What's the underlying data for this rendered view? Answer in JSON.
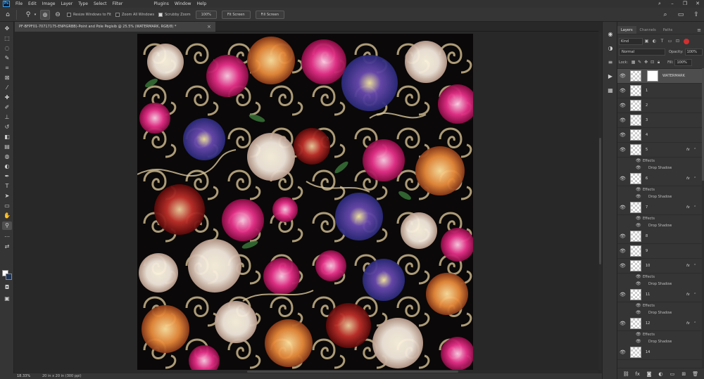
{
  "menu": {
    "app_icon": "Ps",
    "items": [
      "File",
      "Edit",
      "Image",
      "Layer",
      "Type",
      "Select",
      "Filter"
    ],
    "items_right": [
      "Plugins",
      "Window",
      "Help"
    ]
  },
  "window_controls": {
    "search": "⌕",
    "minimize": "–",
    "restore": "❐",
    "close": "✕"
  },
  "options_bar": {
    "resize_windows_label": "Resize Windows to Fit",
    "zoom_all_label": "Zoom All Windows",
    "scrubby_zoom_label": "Scrubby Zoom",
    "scrubby_zoom_checked": true,
    "btn_100": "100%",
    "btn_fit": "Fit Screen",
    "btn_fill": "Fill Screen"
  },
  "document": {
    "tab_title": "PF-BFPF01-70717175-ENPIGRBB)-Point and Pole Pegisib @ 25.5% (WATERMARK, RGB/8) *",
    "close": "×"
  },
  "status": {
    "zoom": "18.33%",
    "doc_size": "20 in x 20 in (300 ppi)"
  },
  "layers_panel": {
    "tabs": [
      "Layers",
      "Channels",
      "Paths"
    ],
    "active_tab": "Layers",
    "filter_kind": "Kind",
    "blend_mode": "Normal",
    "opacity_label": "Opacity:",
    "opacity_value": "100%",
    "lock_label": "Lock:",
    "fill_label": "Fill:",
    "fill_value": "100%",
    "layers": [
      {
        "name": "WATERMARK",
        "selected": true,
        "fx": false
      },
      {
        "name": "1",
        "fx": false
      },
      {
        "name": "2",
        "fx": false
      },
      {
        "name": "3",
        "fx": false
      },
      {
        "name": "4",
        "fx": false
      },
      {
        "name": "5",
        "fx": true,
        "effects": [
          "Effects",
          "Drop Shadow"
        ]
      },
      {
        "name": "6",
        "fx": true,
        "effects": [
          "Effects",
          "Drop Shadow"
        ]
      },
      {
        "name": "7",
        "fx": true,
        "effects": [
          "Effects",
          "Drop Shadow"
        ]
      },
      {
        "name": "8",
        "fx": false
      },
      {
        "name": "9",
        "fx": false
      },
      {
        "name": "10",
        "fx": true,
        "effects": [
          "Effects",
          "Drop Shadow"
        ]
      },
      {
        "name": "11",
        "fx": true,
        "effects": [
          "Effects",
          "Drop Shadow"
        ]
      },
      {
        "name": "12",
        "fx": true,
        "effects": [
          "Effects",
          "Drop Shadow"
        ]
      },
      {
        "name": "14",
        "fx": false
      }
    ]
  },
  "colors": {
    "foreground": "#ffffff",
    "background": "#1e3354",
    "artwork_bg": "#0a0808"
  }
}
